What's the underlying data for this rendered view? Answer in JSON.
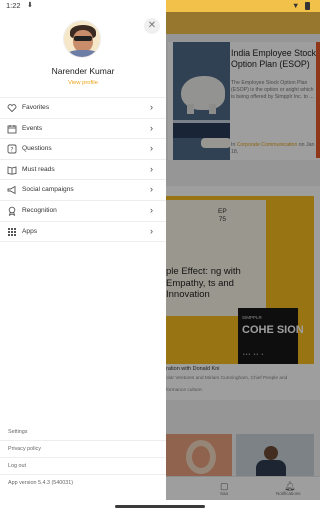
{
  "status_bar": {
    "time": "1:22",
    "download_icon": "download-icon",
    "wifi_icon": "wifi-icon",
    "battery_icon": "battery-icon"
  },
  "drawer": {
    "user_name": "Narender Kumar",
    "view_profile": "View profile",
    "close_icon": "close-icon",
    "menu": [
      {
        "label": "Favorites",
        "icon": "heart-icon"
      },
      {
        "label": "Events",
        "icon": "calendar-icon"
      },
      {
        "label": "Questions",
        "icon": "question-icon"
      },
      {
        "label": "Must reads",
        "icon": "book-icon"
      },
      {
        "label": "Social campaigns",
        "icon": "megaphone-icon"
      },
      {
        "label": "Recognition",
        "icon": "badge-icon"
      },
      {
        "label": "Apps",
        "icon": "apps-grid-icon"
      }
    ],
    "footer": {
      "settings": "Settings",
      "privacy": "Privacy policy",
      "logout": "Log out",
      "version": "App version 5.4.3 (540031)"
    }
  },
  "background": {
    "esop_card": {
      "title": "India Employee Stock Option Plan (ESOP)",
      "description": "The Employee Stock Option Plan (ESOP) is the option or aright which is being offered by Simpplr Inc. to ...",
      "source_prefix": "In",
      "source_org": "Corporate Communication",
      "source_date": "on Jan 18,"
    },
    "podcast_card": {
      "episode_label": "EP",
      "episode_number": "75",
      "title": "ple Effect: ng with Empathy, ts and Innovation",
      "brand_small": "SIMPPLR",
      "brand_big": "COHE SION",
      "caption": "ration with Donald Kni",
      "subtitle": "olar Ventures and Miriam Cunningham, Chief People and",
      "more": "formance culture."
    },
    "bottom_nav": {
      "left_label": "Saa",
      "right_label": "Notifications"
    }
  }
}
